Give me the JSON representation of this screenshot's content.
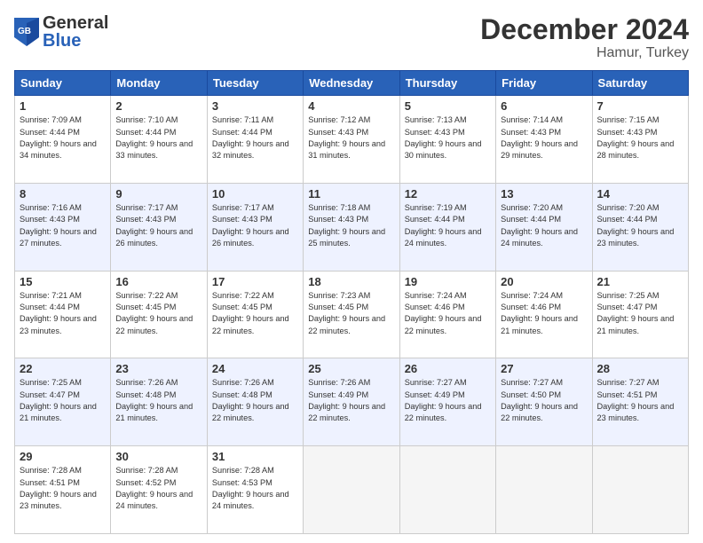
{
  "logo": {
    "general": "General",
    "blue": "Blue"
  },
  "title": "December 2024",
  "subtitle": "Hamur, Turkey",
  "days_of_week": [
    "Sunday",
    "Monday",
    "Tuesday",
    "Wednesday",
    "Thursday",
    "Friday",
    "Saturday"
  ],
  "weeks": [
    [
      {
        "day": "1",
        "sunrise": "Sunrise: 7:09 AM",
        "sunset": "Sunset: 4:44 PM",
        "daylight": "Daylight: 9 hours and 34 minutes."
      },
      {
        "day": "2",
        "sunrise": "Sunrise: 7:10 AM",
        "sunset": "Sunset: 4:44 PM",
        "daylight": "Daylight: 9 hours and 33 minutes."
      },
      {
        "day": "3",
        "sunrise": "Sunrise: 7:11 AM",
        "sunset": "Sunset: 4:44 PM",
        "daylight": "Daylight: 9 hours and 32 minutes."
      },
      {
        "day": "4",
        "sunrise": "Sunrise: 7:12 AM",
        "sunset": "Sunset: 4:43 PM",
        "daylight": "Daylight: 9 hours and 31 minutes."
      },
      {
        "day": "5",
        "sunrise": "Sunrise: 7:13 AM",
        "sunset": "Sunset: 4:43 PM",
        "daylight": "Daylight: 9 hours and 30 minutes."
      },
      {
        "day": "6",
        "sunrise": "Sunrise: 7:14 AM",
        "sunset": "Sunset: 4:43 PM",
        "daylight": "Daylight: 9 hours and 29 minutes."
      },
      {
        "day": "7",
        "sunrise": "Sunrise: 7:15 AM",
        "sunset": "Sunset: 4:43 PM",
        "daylight": "Daylight: 9 hours and 28 minutes."
      }
    ],
    [
      {
        "day": "8",
        "sunrise": "Sunrise: 7:16 AM",
        "sunset": "Sunset: 4:43 PM",
        "daylight": "Daylight: 9 hours and 27 minutes."
      },
      {
        "day": "9",
        "sunrise": "Sunrise: 7:17 AM",
        "sunset": "Sunset: 4:43 PM",
        "daylight": "Daylight: 9 hours and 26 minutes."
      },
      {
        "day": "10",
        "sunrise": "Sunrise: 7:17 AM",
        "sunset": "Sunset: 4:43 PM",
        "daylight": "Daylight: 9 hours and 26 minutes."
      },
      {
        "day": "11",
        "sunrise": "Sunrise: 7:18 AM",
        "sunset": "Sunset: 4:43 PM",
        "daylight": "Daylight: 9 hours and 25 minutes."
      },
      {
        "day": "12",
        "sunrise": "Sunrise: 7:19 AM",
        "sunset": "Sunset: 4:44 PM",
        "daylight": "Daylight: 9 hours and 24 minutes."
      },
      {
        "day": "13",
        "sunrise": "Sunrise: 7:20 AM",
        "sunset": "Sunset: 4:44 PM",
        "daylight": "Daylight: 9 hours and 24 minutes."
      },
      {
        "day": "14",
        "sunrise": "Sunrise: 7:20 AM",
        "sunset": "Sunset: 4:44 PM",
        "daylight": "Daylight: 9 hours and 23 minutes."
      }
    ],
    [
      {
        "day": "15",
        "sunrise": "Sunrise: 7:21 AM",
        "sunset": "Sunset: 4:44 PM",
        "daylight": "Daylight: 9 hours and 23 minutes."
      },
      {
        "day": "16",
        "sunrise": "Sunrise: 7:22 AM",
        "sunset": "Sunset: 4:45 PM",
        "daylight": "Daylight: 9 hours and 22 minutes."
      },
      {
        "day": "17",
        "sunrise": "Sunrise: 7:22 AM",
        "sunset": "Sunset: 4:45 PM",
        "daylight": "Daylight: 9 hours and 22 minutes."
      },
      {
        "day": "18",
        "sunrise": "Sunrise: 7:23 AM",
        "sunset": "Sunset: 4:45 PM",
        "daylight": "Daylight: 9 hours and 22 minutes."
      },
      {
        "day": "19",
        "sunrise": "Sunrise: 7:24 AM",
        "sunset": "Sunset: 4:46 PM",
        "daylight": "Daylight: 9 hours and 22 minutes."
      },
      {
        "day": "20",
        "sunrise": "Sunrise: 7:24 AM",
        "sunset": "Sunset: 4:46 PM",
        "daylight": "Daylight: 9 hours and 21 minutes."
      },
      {
        "day": "21",
        "sunrise": "Sunrise: 7:25 AM",
        "sunset": "Sunset: 4:47 PM",
        "daylight": "Daylight: 9 hours and 21 minutes."
      }
    ],
    [
      {
        "day": "22",
        "sunrise": "Sunrise: 7:25 AM",
        "sunset": "Sunset: 4:47 PM",
        "daylight": "Daylight: 9 hours and 21 minutes."
      },
      {
        "day": "23",
        "sunrise": "Sunrise: 7:26 AM",
        "sunset": "Sunset: 4:48 PM",
        "daylight": "Daylight: 9 hours and 21 minutes."
      },
      {
        "day": "24",
        "sunrise": "Sunrise: 7:26 AM",
        "sunset": "Sunset: 4:48 PM",
        "daylight": "Daylight: 9 hours and 22 minutes."
      },
      {
        "day": "25",
        "sunrise": "Sunrise: 7:26 AM",
        "sunset": "Sunset: 4:49 PM",
        "daylight": "Daylight: 9 hours and 22 minutes."
      },
      {
        "day": "26",
        "sunrise": "Sunrise: 7:27 AM",
        "sunset": "Sunset: 4:49 PM",
        "daylight": "Daylight: 9 hours and 22 minutes."
      },
      {
        "day": "27",
        "sunrise": "Sunrise: 7:27 AM",
        "sunset": "Sunset: 4:50 PM",
        "daylight": "Daylight: 9 hours and 22 minutes."
      },
      {
        "day": "28",
        "sunrise": "Sunrise: 7:27 AM",
        "sunset": "Sunset: 4:51 PM",
        "daylight": "Daylight: 9 hours and 23 minutes."
      }
    ],
    [
      {
        "day": "29",
        "sunrise": "Sunrise: 7:28 AM",
        "sunset": "Sunset: 4:51 PM",
        "daylight": "Daylight: 9 hours and 23 minutes."
      },
      {
        "day": "30",
        "sunrise": "Sunrise: 7:28 AM",
        "sunset": "Sunset: 4:52 PM",
        "daylight": "Daylight: 9 hours and 24 minutes."
      },
      {
        "day": "31",
        "sunrise": "Sunrise: 7:28 AM",
        "sunset": "Sunset: 4:53 PM",
        "daylight": "Daylight: 9 hours and 24 minutes."
      },
      null,
      null,
      null,
      null
    ]
  ]
}
